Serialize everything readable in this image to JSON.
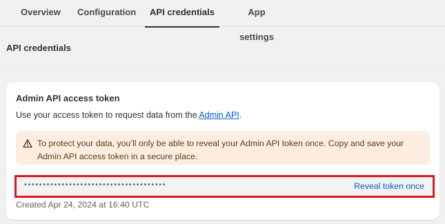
{
  "tabs": [
    {
      "label": "Overview",
      "active": false
    },
    {
      "label": "Configuration",
      "active": false
    },
    {
      "label": "API credentials",
      "active": true
    },
    {
      "label": "App settings",
      "active": false
    }
  ],
  "section": {
    "title": "API credentials"
  },
  "card": {
    "title": "Admin API access token",
    "description_prefix": "Use your access token to request data from the ",
    "description_link": "Admin API",
    "description_suffix": ".",
    "warning": {
      "icon": "warning-triangle-icon",
      "text": "To protect your data, you’ll only be able to reveal your Admin API token once. Copy and save your Admin API access token in a secure place."
    },
    "token": {
      "masked_value": "••••••••••••••••••••••••••••••••••••••",
      "reveal_label": "Reveal token once"
    },
    "created": "Created Apr 24, 2024 at 16:40 UTC"
  },
  "colors": {
    "link": "#005bd3",
    "warning_bg": "#fcede0",
    "highlight_outline": "#e0141b"
  }
}
